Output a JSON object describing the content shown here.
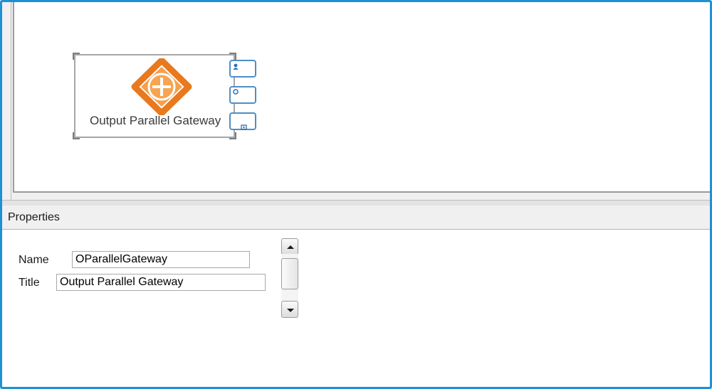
{
  "canvas": {
    "gateway_node": {
      "label": "Output Parallel Gateway",
      "icon": "parallel-gateway-icon",
      "accent_color": "#e8791e"
    },
    "context_buttons": [
      {
        "icon": "user-task-icon"
      },
      {
        "icon": "intermediate-event-icon"
      },
      {
        "icon": "sub-process-icon"
      }
    ]
  },
  "properties": {
    "title": "Properties",
    "fields": [
      {
        "label": "Name",
        "value": "OParallelGateway"
      },
      {
        "label": "Title",
        "value": "Output Parallel Gateway"
      }
    ],
    "scrollbar": {
      "up_icon": "arrow-up-icon",
      "down_icon": "arrow-down-icon"
    }
  }
}
